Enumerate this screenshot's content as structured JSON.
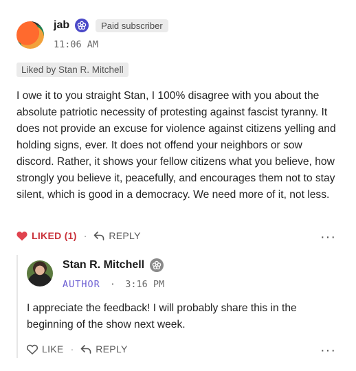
{
  "comment": {
    "author": "jab",
    "badge_icon": "flower-badge-icon",
    "subscriber_label": "Paid subscriber",
    "time": "11:06 AM",
    "liked_by": "Liked by Stan R. Mitchell",
    "body": "I owe it to you straight Stan, I 100% disagree with you about the absolute patriotic necessity of protesting against fascist tyranny. It does not provide an excuse for violence against citizens yelling and holding signs, ever. It does not offend your neighbors or sow discord. Rather, it shows your fellow citizens what you believe, how strongly you believe it, peacefully, and encourages them not to stay silent, which is good in a democracy. We need more of it, not less.",
    "like_label": "LIKED (1)",
    "separator": "·",
    "reply_label": "REPLY",
    "more": "···",
    "accent_color": "#c9313a"
  },
  "reply": {
    "author": "Stan R. Mitchell",
    "role": "AUTHOR",
    "separator": "·",
    "time": "3:16 PM",
    "body": "I appreciate the feedback! I will probably share this in the beginning of the show next week.",
    "like_label": "LIKE",
    "reply_label": "REPLY",
    "more": "···",
    "role_color": "#6d5fd3"
  }
}
